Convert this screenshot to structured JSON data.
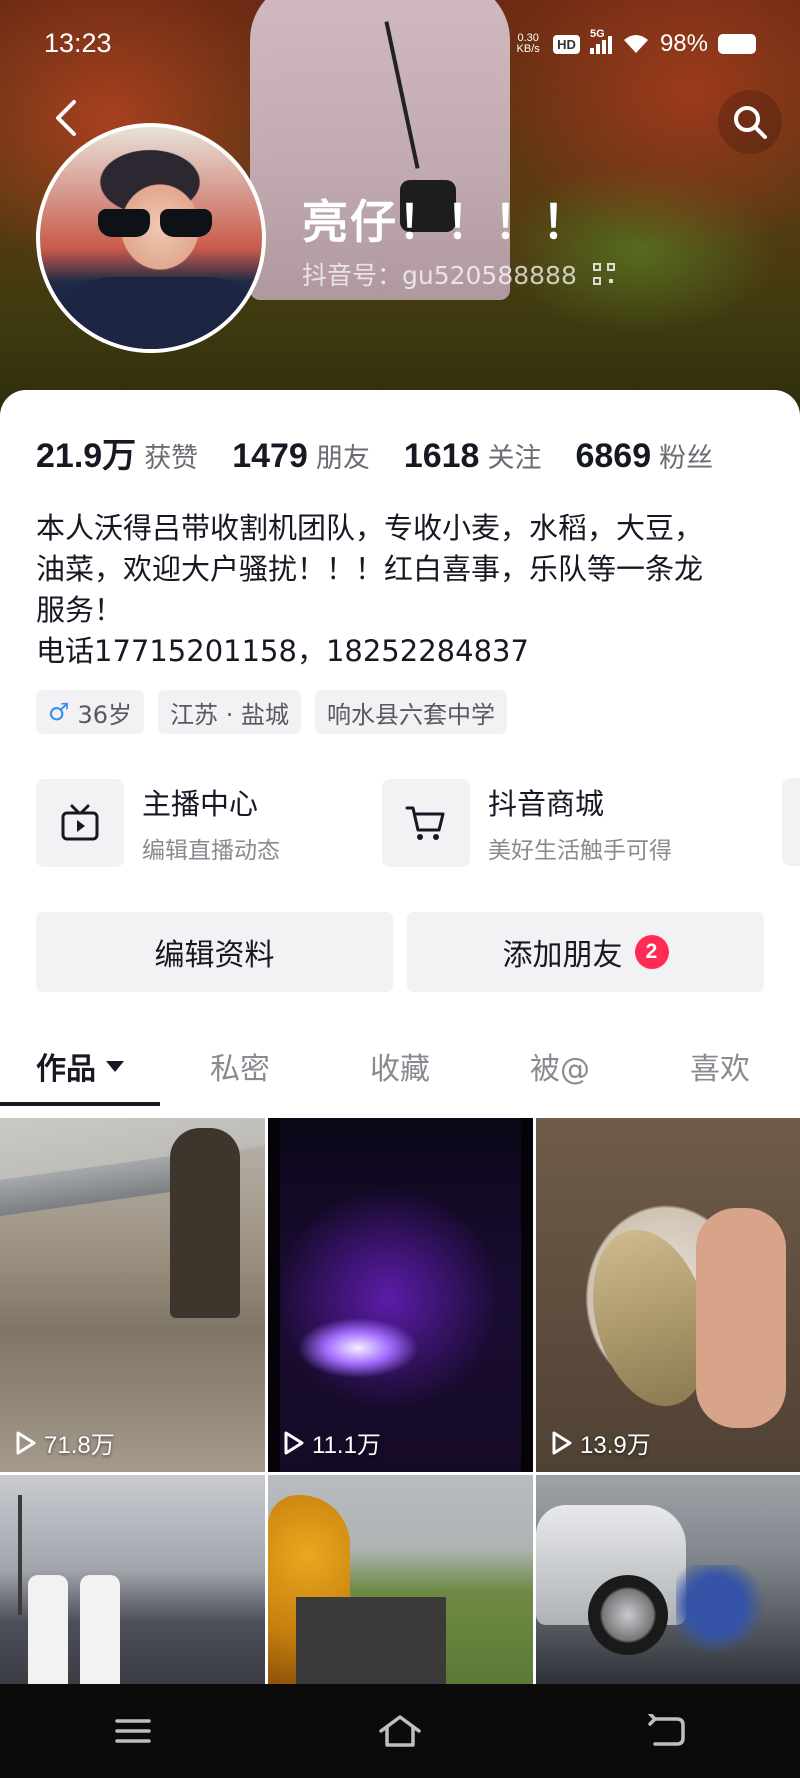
{
  "status_bar": {
    "time": "13:23",
    "net_speed_value": "0.30",
    "net_speed_unit": "KB/s",
    "hd_label": "HD",
    "network_label": "5G",
    "battery": "98%"
  },
  "profile": {
    "nickname": "亮仔！！！！",
    "douyin_id": "抖音号：gu520588888"
  },
  "stats": [
    {
      "value": "21.9万",
      "label": "获赞"
    },
    {
      "value": "1479",
      "label": "朋友"
    },
    {
      "value": "1618",
      "label": "关注"
    },
    {
      "value": "6869",
      "label": "粉丝"
    }
  ],
  "bio": {
    "line1": "本人沃得吕带收割机团队，专收小麦，水稻，大豆，",
    "line2": "油菜，欢迎大户骚扰！！！红白喜事，乐队等一条龙",
    "line3": "服务！",
    "line4": "电话17715201158，18252284837"
  },
  "tags": {
    "gender_symbol": "♂",
    "age": "36岁",
    "location": "江苏 · 盐城",
    "school": "响水县六套中学"
  },
  "services": [
    {
      "title": "主播中心",
      "subtitle": "编辑直播动态",
      "icon": "tv-icon"
    },
    {
      "title": "抖音商城",
      "subtitle": "美好生活触手可得",
      "icon": "cart-icon"
    }
  ],
  "actions": {
    "edit_profile": "编辑资料",
    "add_friends": "添加朋友",
    "add_friends_badge": "2"
  },
  "tabs": [
    {
      "label": "作品",
      "active": true
    },
    {
      "label": "私密",
      "active": false
    },
    {
      "label": "收藏",
      "active": false
    },
    {
      "label": "被@",
      "active": false
    },
    {
      "label": "喜欢",
      "active": false
    }
  ],
  "videos": [
    {
      "plays": "71.8万"
    },
    {
      "plays": "11.1万"
    },
    {
      "plays": "13.9万"
    },
    {
      "plays": ""
    },
    {
      "plays": ""
    },
    {
      "plays": ""
    }
  ],
  "colors": {
    "accent_badge": "#fe2c55",
    "text_primary": "#161823",
    "text_secondary": "#8a8b91",
    "chip_bg": "#f2f2f4",
    "male_blue": "#3a8df7"
  }
}
